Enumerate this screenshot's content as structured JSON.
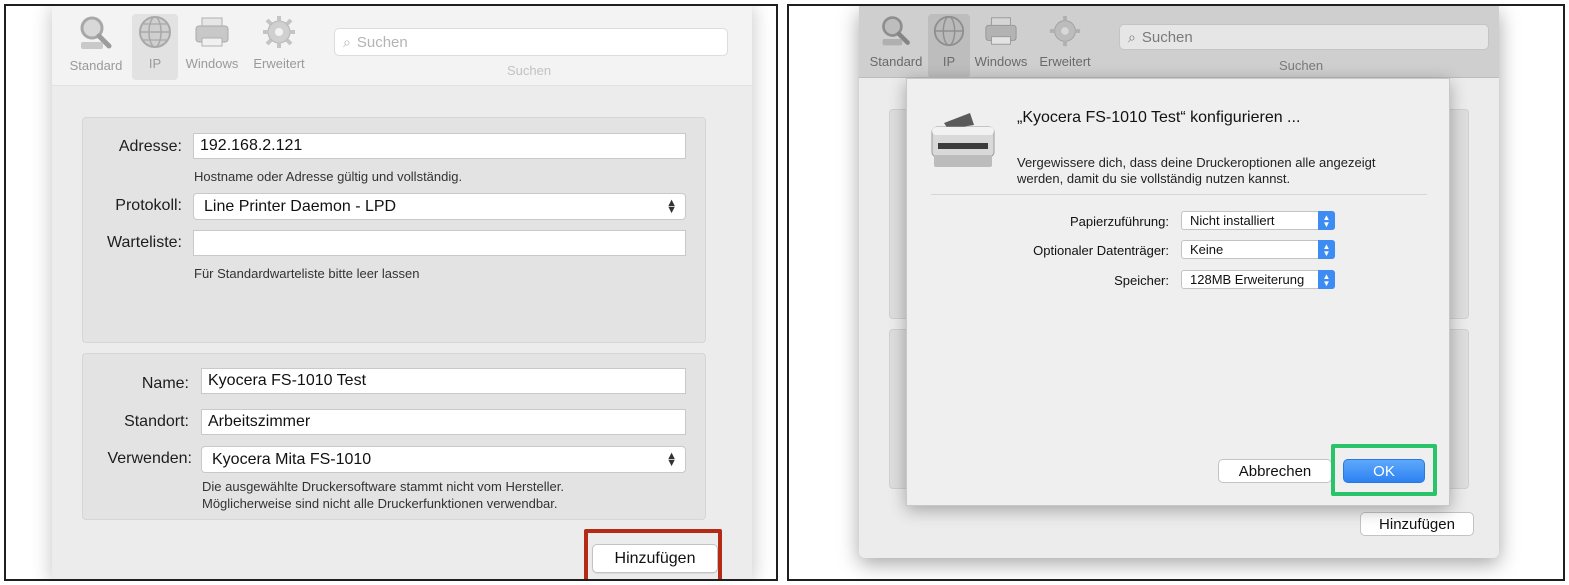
{
  "colors": {
    "highlight_red": "#b52a14",
    "highlight_green": "#29c36a",
    "accent_blue": "#3d8cf4"
  },
  "toolbar": {
    "tabs": [
      {
        "label": "Standard",
        "icon": "magnifier-printer-icon"
      },
      {
        "label": "IP",
        "icon": "globe-icon"
      },
      {
        "label": "Windows",
        "icon": "printer-icon"
      },
      {
        "label": "Erweitert",
        "icon": "gear-icon"
      }
    ],
    "search_placeholder": "Suchen",
    "search_caption": "Suchen"
  },
  "left": {
    "address_label": "Adresse:",
    "address_value": "192.168.2.121",
    "address_hint": "Hostname oder Adresse gültig und vollständig.",
    "protocol_label": "Protokoll:",
    "protocol_value": "Line Printer Daemon - LPD",
    "queue_label": "Warteliste:",
    "queue_value": "",
    "queue_hint": "Für Standardwarteliste bitte leer lassen",
    "name_label": "Name:",
    "name_value": "Kyocera FS-1010 Test",
    "location_label": "Standort:",
    "location_value": "Arbeitszimmer",
    "use_label": "Verwenden:",
    "use_value": "Kyocera Mita FS-1010",
    "driver_warning_1": "Die ausgewählte Druckersoftware stammt nicht vom Hersteller.",
    "driver_warning_2": "Möglicherweise sind nicht alle Druckerfunktionen verwendbar.",
    "add_button": "Hinzufügen"
  },
  "right": {
    "sheet_title": "„Kyocera FS-1010 Test“ konfigurieren ...",
    "sheet_subtitle_1": "Vergewissere dich, dass deine Druckeroptionen alle angezeigt",
    "sheet_subtitle_2": "werden, damit du sie vollständig nutzen kannst.",
    "options": [
      {
        "label": "Papierzuführung:",
        "value": "Nicht installiert"
      },
      {
        "label": "Optionaler Datenträger:",
        "value": "Keine"
      },
      {
        "label": "Speicher:",
        "value": "128MB Erweiterung"
      }
    ],
    "cancel_button": "Abbrechen",
    "ok_button": "OK",
    "add_button": "Hinzufügen"
  }
}
